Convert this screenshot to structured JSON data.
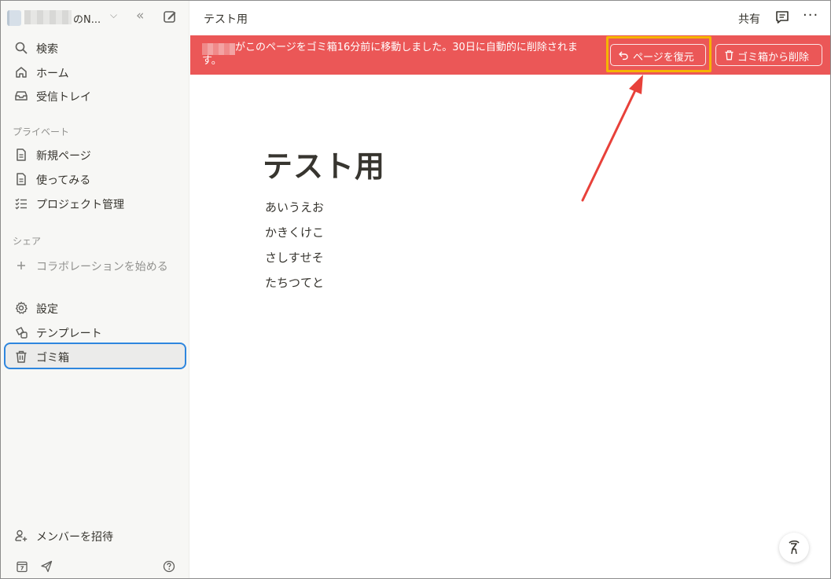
{
  "workspace": {
    "name_suffix": "のN...",
    "chevron": "chevron-down-icon",
    "collapse": "double-chevron-left-icon",
    "new_page": "edit-icon"
  },
  "sidebar": {
    "items": [
      {
        "label": "検索",
        "icon": "search-icon"
      },
      {
        "label": "ホーム",
        "icon": "home-icon"
      },
      {
        "label": "受信トレイ",
        "icon": "inbox-icon"
      }
    ],
    "private_label": "プライベート",
    "private_items": [
      {
        "label": "新規ページ",
        "icon": "page-icon"
      },
      {
        "label": "使ってみる",
        "icon": "page-icon"
      },
      {
        "label": "プロジェクト管理",
        "icon": "checklist-icon"
      }
    ],
    "shared_label": "シェア",
    "shared_items": [
      {
        "label": "コラボレーションを始める",
        "icon": "plus-icon"
      }
    ],
    "tool_items": [
      {
        "label": "設定",
        "icon": "gear-icon"
      },
      {
        "label": "テンプレート",
        "icon": "templates-icon"
      },
      {
        "label": "ゴミ箱",
        "icon": "trash-icon",
        "selected": true
      }
    ],
    "invite": {
      "label": "メンバーを招待",
      "icon": "invite-user-icon"
    },
    "bottom_icons": [
      "calendar-icon",
      "send-icon",
      "help-icon"
    ]
  },
  "topbar": {
    "breadcrumb": "テスト用",
    "share": "共有",
    "comment_icon": "comment-icon",
    "more_icon": "more-icon"
  },
  "banner": {
    "message": "がこのページをゴミ箱16分前に移動しました。30日に自動的に削除されます。",
    "restore_label": "ページを復元",
    "delete_label": "ゴミ箱から削除",
    "color": "#eb5757",
    "highlight_color": "#f5b400"
  },
  "page": {
    "title": "テスト用",
    "blocks": [
      "あいうえお",
      "かきくけこ",
      "さしすせそ",
      "たちつてと"
    ]
  },
  "annotation": {
    "arrow_color": "#e8413a"
  }
}
